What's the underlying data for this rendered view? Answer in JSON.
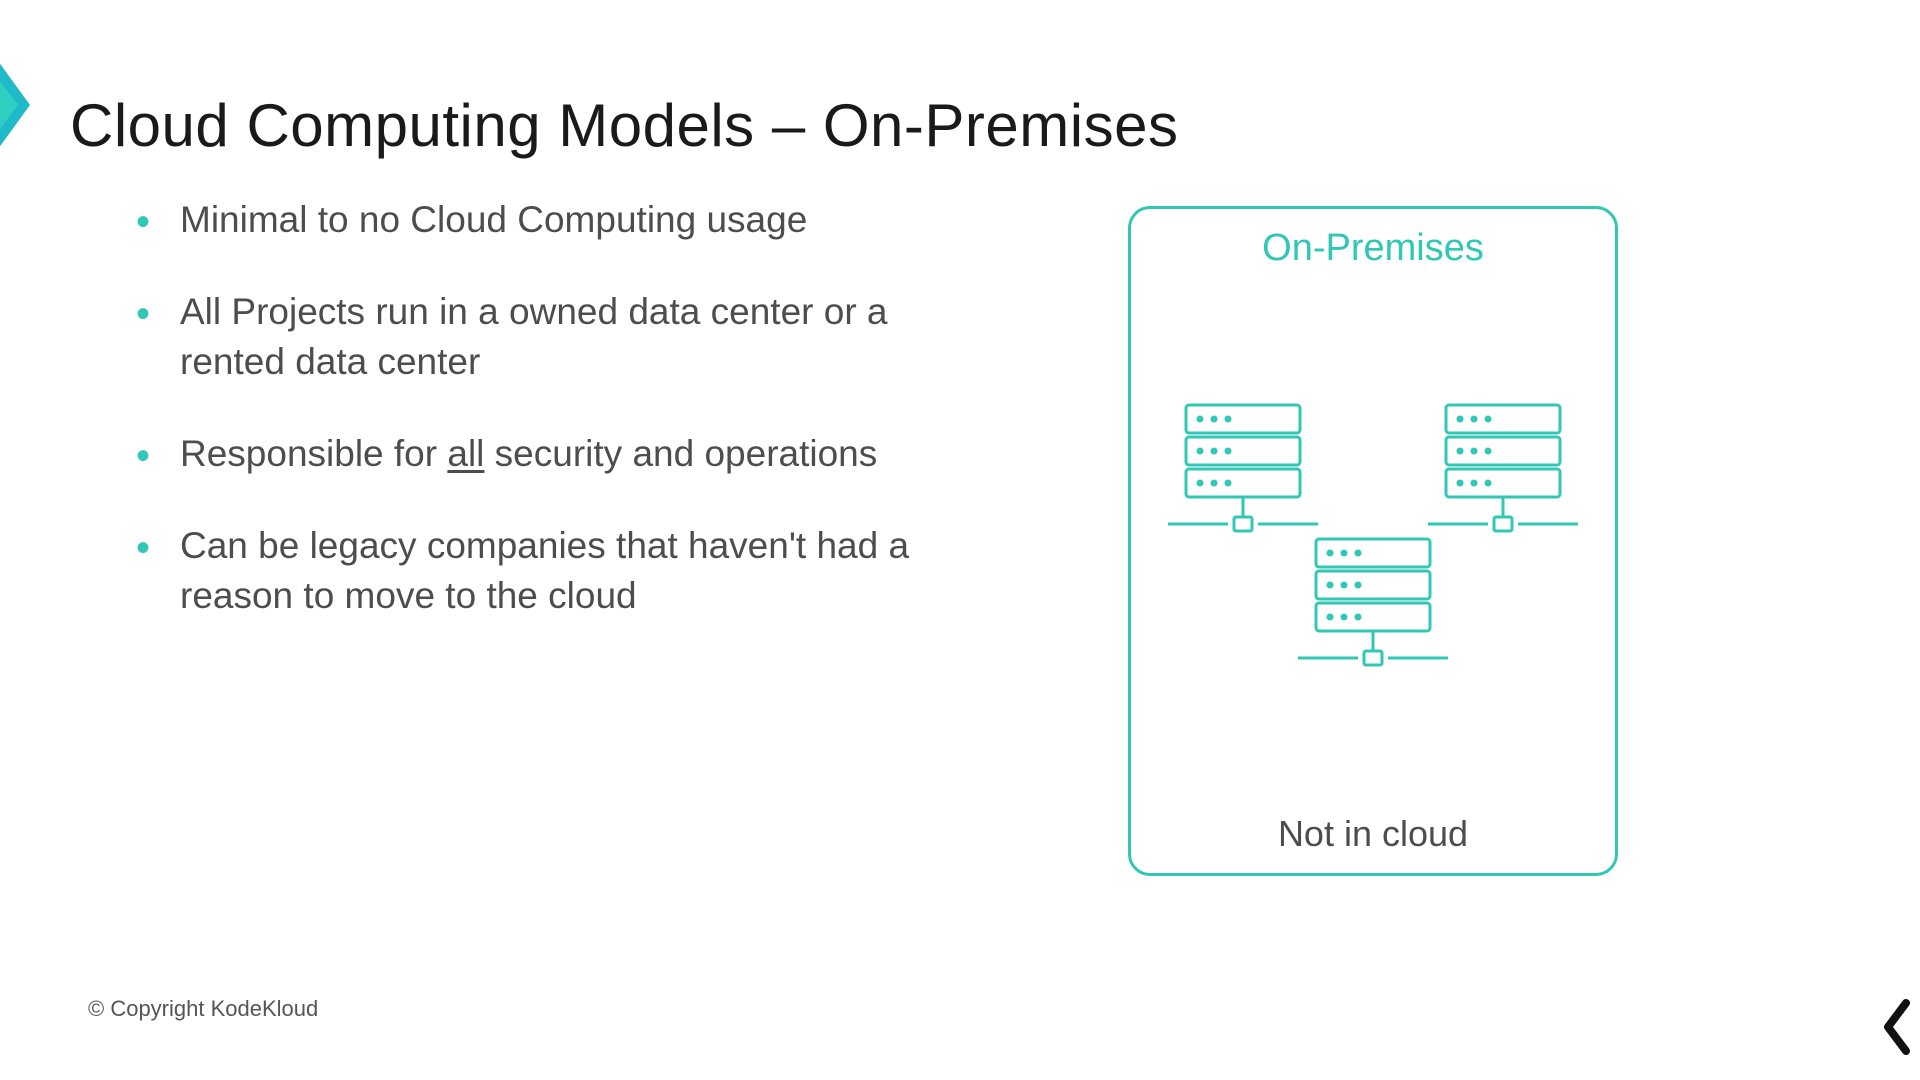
{
  "colors": {
    "accent": "#30c7b5",
    "text": "#4d4d4d",
    "title": "#1a1a1a"
  },
  "title": "Cloud Computing Models – On-Premises",
  "bullets": [
    {
      "text": "Minimal to no Cloud Computing usage"
    },
    {
      "text_pre": "All Projects run in a owned data center or a rented data center"
    },
    {
      "text_pre": "Responsible for ",
      "underlined": "all",
      "text_post": " security and operations"
    },
    {
      "text_pre": "Can be legacy companies that haven't had a reason to move to the cloud"
    }
  ],
  "diagram": {
    "title": "On-Premises",
    "caption": "Not in cloud",
    "server_icon": "server-rack-icon",
    "server_count": 3
  },
  "footer": {
    "copyright": "© Copyright KodeKloud"
  },
  "icons": {
    "title_chevron": "chevron-right-icon",
    "corner_chevron": "chevron-left-icon"
  }
}
